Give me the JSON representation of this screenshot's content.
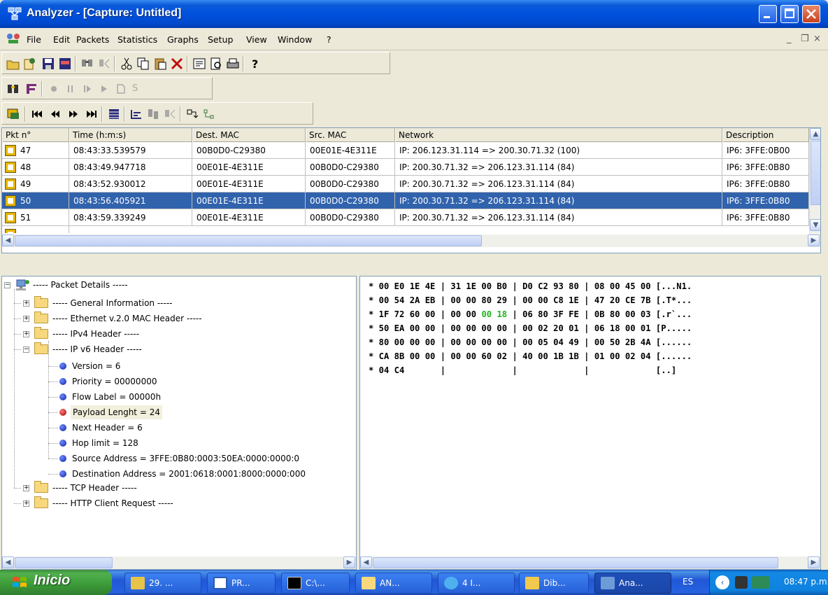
{
  "window": {
    "title": "Analyzer - [Capture: Untitled]"
  },
  "menu": {
    "items": [
      "File",
      "Edit",
      "Packets",
      "Statistics",
      "Graphs",
      "Setup",
      "View",
      "Window",
      "?"
    ],
    "mdi": [
      "_",
      "❒",
      "×"
    ]
  },
  "toolbar2": {
    "s_label": "S"
  },
  "packets": {
    "headers": [
      "Pkt n°",
      "Time (h:m:s)",
      "Dest. MAC",
      "Src. MAC",
      "Network",
      "Description"
    ],
    "rows": [
      {
        "n": "47",
        "time": "08:43:33.539579",
        "dst": "00B0D0-C29380",
        "src": "00E01E-4E311E",
        "net": "IP: 206.123.31.114 => 200.30.71.32 (100)",
        "desc": "IP6: 3FFE:0B00"
      },
      {
        "n": "48",
        "time": "08:43:49.947718",
        "dst": "00E01E-4E311E",
        "src": "00B0D0-C29380",
        "net": "IP: 200.30.71.32 => 206.123.31.114 (84)",
        "desc": "IP6: 3FFE:0B80"
      },
      {
        "n": "49",
        "time": "08:43:52.930012",
        "dst": "00E01E-4E311E",
        "src": "00B0D0-C29380",
        "net": "IP: 200.30.71.32 => 206.123.31.114 (84)",
        "desc": "IP6: 3FFE:0B80"
      },
      {
        "n": "50",
        "time": "08:43:56.405921",
        "dst": "00E01E-4E311E",
        "src": "00B0D0-C29380",
        "net": "IP: 200.30.71.32 => 206.123.31.114 (84)",
        "desc": "IP6: 3FFE:0B80",
        "selected": true
      },
      {
        "n": "51",
        "time": "08:43:59.339249",
        "dst": "00E01E-4E311E",
        "src": "00B0D0-C29380",
        "net": "IP: 200.30.71.32 => 206.123.31.114 (84)",
        "desc": "IP6: 3FFE:0B80"
      }
    ]
  },
  "tree": {
    "root": "----- Packet Details -----",
    "general": "----- General Information -----",
    "ethernet": "----- Ethernet v.2.0 MAC Header -----",
    "ipv4": "----- IPv4 Header -----",
    "ipv6": "----- IP v6 Header -----",
    "fields": [
      "Version = 6",
      "Priority = 00000000",
      "Flow Label = 00000h",
      "Payload Lenght = 24",
      "Next Header = 6",
      "Hop limit = 128",
      "Source Address = 3FFE:0B80:0003:50EA:0000:0000:0",
      "Destination Address = 2001:0618:0001:8000:0000:000"
    ],
    "tcp": "----- TCP Header -----",
    "http": "----- HTTP Client Request -----"
  },
  "hex": {
    "lines": [
      {
        "a": "* 00 E0 1E 4E | 31 1E 00 B0 | D0 C2 93 80 | 08 00 45 00 [...N1."
      },
      {
        "a": "* 00 54 2A EB | 00 00 80 29 | 00 00 C8 1E | 47 20 CE 7B [.T*..."
      },
      {
        "a": "* 1F 72 60 00 | 00 00 ",
        "g": "00 18",
        "b": " | 06 80 3F FE | 0B 80 00 03 [.r`..."
      },
      {
        "a": "* 50 EA 00 00 | 00 00 00 00 | 00 02 20 01 | 06 18 00 01 [P....."
      },
      {
        "a": "* 80 00 00 00 | 00 00 00 00 | 00 05 04 49 | 00 50 2B 4A [......"
      },
      {
        "a": "* CA 8B 00 00 | 00 00 60 02 | 40 00 1B 1B | 01 00 02 04 [......"
      },
      {
        "a": "* 04 C4       |             |             |             [..]"
      }
    ]
  },
  "taskbar": {
    "start": "Inicio",
    "buttons": [
      "29. ...",
      "PR...",
      "C:\\...",
      "AN...",
      "4 I...",
      "Dib...",
      "Ana..."
    ],
    "lang": "ES",
    "clock": "08:47 p.m."
  },
  "colors": {
    "selection": "#3163AD",
    "hex_highlight": "#1FB51F",
    "titlebar": "#0151DE"
  }
}
